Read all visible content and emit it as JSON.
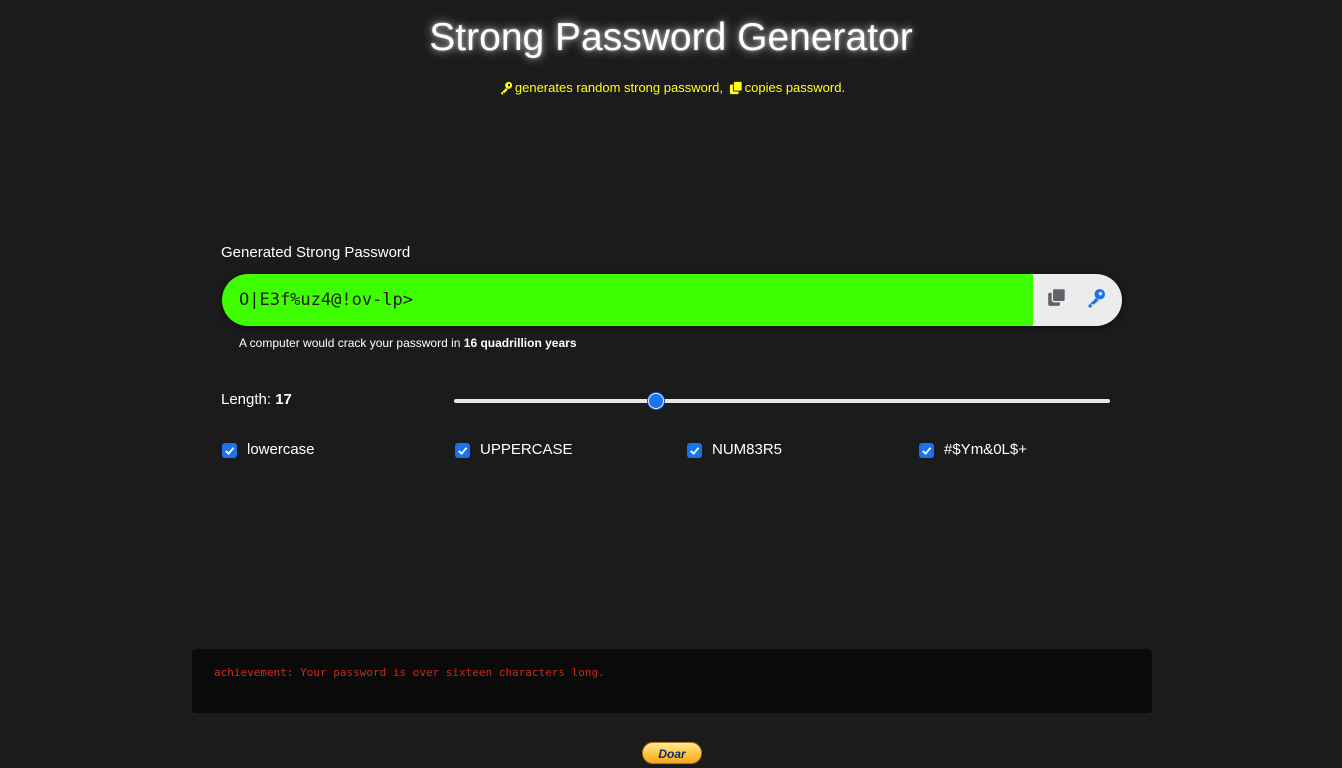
{
  "header": {
    "title": "Strong Password Generator",
    "subtitle_part1": "generates random strong password,",
    "subtitle_part2": "copies password.",
    "subtitle_icon1": "key-icon",
    "subtitle_icon2": "copy-icon"
  },
  "password": {
    "label": "Generated Strong Password",
    "value": "O|E3f%uz4@!ov-lp>",
    "field_color": "#3dff00",
    "copy_icon": "copy-icon",
    "generate_icon": "key-icon"
  },
  "strength": {
    "prefix": "A computer would crack your password in",
    "duration": "16 quadrillion years"
  },
  "length": {
    "label": "Length:",
    "value": "17",
    "slider_fraction": 0.308
  },
  "options": [
    {
      "label": "lowercase",
      "checked": true
    },
    {
      "label": "UPPERCASE",
      "checked": true
    },
    {
      "label": "NUM83R5",
      "checked": true
    },
    {
      "label": "#$Ym&0L$+",
      "checked": true
    }
  ],
  "console": {
    "keyword": "achievement:",
    "message": "Your password is over sixteen characters long."
  },
  "donate": {
    "label": "Doar"
  },
  "colors": {
    "accent": "#1a73e8",
    "subtitle": "#ffff1e",
    "console_text": "#c42b1c"
  }
}
